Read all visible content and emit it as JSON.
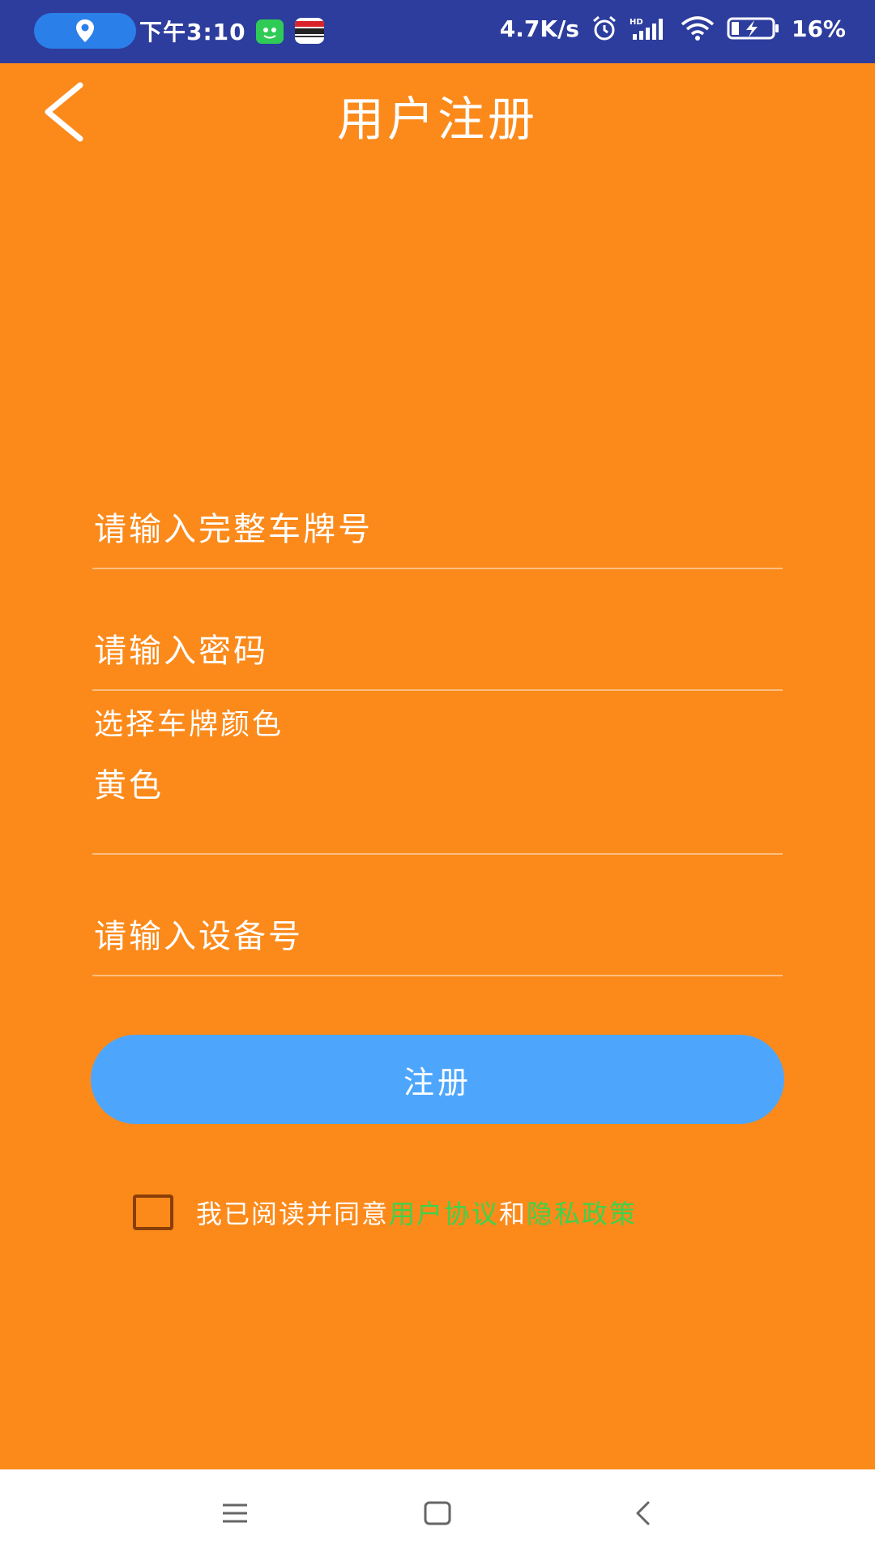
{
  "status_bar": {
    "time": "下午3:10",
    "network_speed": "4.7K/s",
    "battery": "16%",
    "icons": [
      "location-icon",
      "app-notification-icon",
      "card-app-icon",
      "alarm-icon",
      "hd-signal-icon",
      "wifi-icon",
      "battery-charging-icon"
    ]
  },
  "header": {
    "title": "用户注册",
    "back_icon": "chevron-left-icon"
  },
  "form": {
    "plate_placeholder": "请输入完整车牌号",
    "password_placeholder": "请输入密码",
    "plate_color_label": "选择车牌颜色",
    "plate_color_value": "黄色",
    "device_placeholder": "请输入设备号",
    "submit_label": "注册"
  },
  "agreement": {
    "prefix": "我已阅读并同意",
    "user_agreement": "用户协议",
    "and": "和",
    "privacy_policy": "隐私政策"
  },
  "colors": {
    "background": "#fb8a1b",
    "status_bar": "#2d3d9d",
    "button": "#4ea6fc",
    "link": "#3ed24a",
    "checkbox_border": "#8a3e08"
  },
  "nav_bar": {
    "icons": [
      "menu-icon",
      "home-square-icon",
      "back-triangle-icon"
    ]
  }
}
